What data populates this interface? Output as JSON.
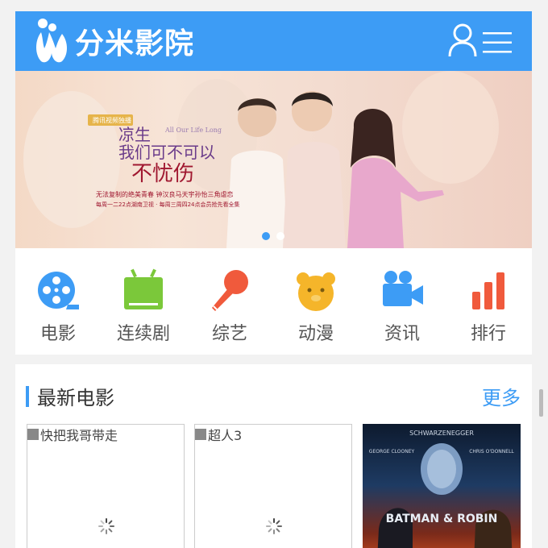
{
  "header": {
    "logo_text": "分米影院",
    "logo_icon": "logo-mark-icon",
    "user_icon": "user-icon",
    "menu_icon": "menu-icon",
    "color": "#3d9cf5"
  },
  "banner": {
    "slides": 2,
    "active_slide": 1,
    "title_lines": [
      "凉生",
      "我们可不可以",
      "不忧伤"
    ],
    "english": "All Our Life Long",
    "badge": "腾讯视频独播",
    "caption1": "无法复制的绝美青春 钟汉良马天宇孙怡三角虐恋",
    "caption2": "每周一二22点湖南卫视 · 每周三周四24点会员抢先看全集"
  },
  "nav": {
    "items": [
      {
        "label": "电影",
        "icon": "film-reel-icon",
        "color": "#3d9cf5"
      },
      {
        "label": "连续剧",
        "icon": "tv-icon",
        "color": "#7bc83a"
      },
      {
        "label": "综艺",
        "icon": "microphone-icon",
        "color": "#f05a3c"
      },
      {
        "label": "动漫",
        "icon": "bear-face-icon",
        "color": "#f5b52a"
      },
      {
        "label": "资讯",
        "icon": "video-camera-icon",
        "color": "#3d9cf5"
      },
      {
        "label": "排行",
        "icon": "bar-chart-icon",
        "color": "#f05a3c"
      }
    ]
  },
  "latest": {
    "title": "最新电影",
    "more": "更多",
    "movies": [
      {
        "alt": "快把我哥带走",
        "loaded": false
      },
      {
        "alt": "超人3",
        "loaded": false
      },
      {
        "title": "BATMAN & ROBIN",
        "top": "SCHWARZENEGGER",
        "left_name": "GEORGE CLOONEY",
        "right_name": "CHRIS O'DONNELL",
        "loaded": true
      }
    ]
  }
}
